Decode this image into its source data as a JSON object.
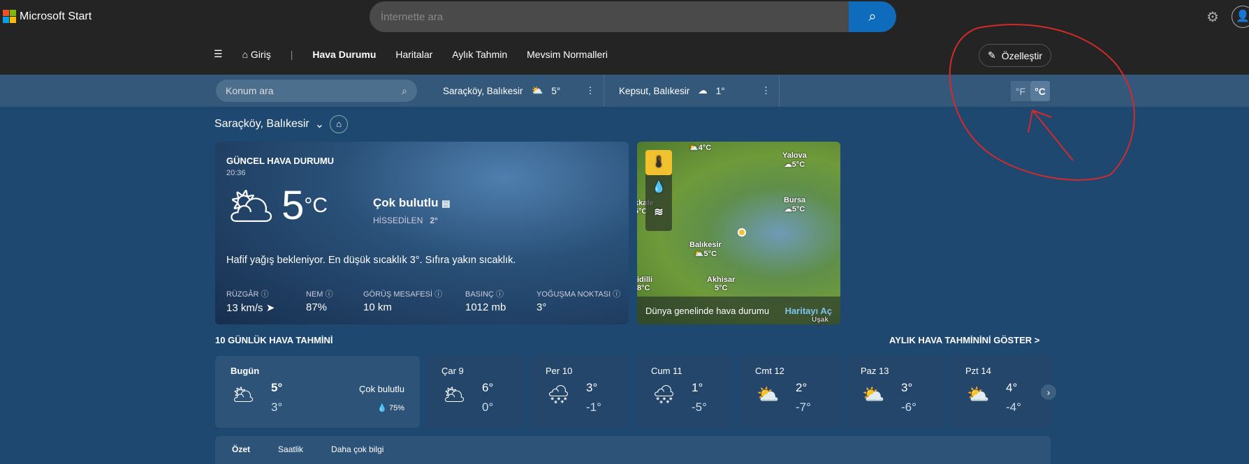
{
  "header": {
    "brand": "Microsoft Start",
    "search_placeholder": "İnternette ara"
  },
  "nav": {
    "items": [
      "Giriş",
      "Hava Durumu",
      "Haritalar",
      "Aylık Tahmin",
      "Mevsim Normalleri"
    ],
    "customize": "Özelleştir"
  },
  "locbar": {
    "placeholder": "Konum ara",
    "favorites": [
      {
        "name": "Saraçköy, Balıkesir",
        "temp": "5°"
      },
      {
        "name": "Kepsut, Balıkesir",
        "temp": "1°"
      }
    ],
    "units": [
      "°F",
      "°C"
    ],
    "active_unit": "°C"
  },
  "location": "Saraçköy, Balıkesir",
  "current": {
    "title": "GÜNCEL HAVA DURUMU",
    "time": "20:36",
    "temp": "5",
    "unit": "°C",
    "condition": "Çok bulutlu",
    "feels_label": "HİSSEDİLEN",
    "feels": "2°",
    "description": "Hafif yağış bekleniyor. En düşük sıcaklık 3°. Sıfıra yakın sıcaklık.",
    "stats": [
      {
        "label": "RÜZGÂR",
        "value": "13 km/s"
      },
      {
        "label": "NEM",
        "value": "87%"
      },
      {
        "label": "GÖRÜŞ MESAFESİ",
        "value": "10 km"
      },
      {
        "label": "BASINÇ",
        "value": "1012 mb"
      },
      {
        "label": "YOĞUŞMA NOKTASI",
        "value": "3°"
      }
    ]
  },
  "map": {
    "labels": [
      {
        "city": "",
        "temp": "4°C"
      },
      {
        "city": "Yalova",
        "temp": "5°C"
      },
      {
        "city": "Bursa",
        "temp": "5°C"
      },
      {
        "city": "Balıkesir",
        "temp": "5°C"
      },
      {
        "city": "kkale",
        "temp": "5°C"
      },
      {
        "city": "idilli",
        "temp": "8°C"
      },
      {
        "city": "Akhisar",
        "temp": "5°C"
      },
      {
        "city": "Uşak",
        "temp": ""
      }
    ],
    "footer": "Dünya genelinde hava durumu",
    "open": "Haritayı Aç"
  },
  "forecast": {
    "title": "10 GÜNLÜK HAVA TAHMİNİ",
    "monthly_link": "AYLIK HAVA TAHMİNİNİ GÖSTER >",
    "days": [
      {
        "day": "Bugün",
        "hi": "5°",
        "lo": "3°",
        "cond": "Çok bulutlu",
        "precip": "75%"
      },
      {
        "day": "Çar 9",
        "hi": "6°",
        "lo": "0°"
      },
      {
        "day": "Per 10",
        "hi": "3°",
        "lo": "-1°"
      },
      {
        "day": "Cum 11",
        "hi": "1°",
        "lo": "-5°"
      },
      {
        "day": "Cmt 12",
        "hi": "2°",
        "lo": "-7°"
      },
      {
        "day": "Paz 13",
        "hi": "3°",
        "lo": "-6°"
      },
      {
        "day": "Pzt 14",
        "hi": "4°",
        "lo": "-4°"
      }
    ]
  },
  "tabs": [
    "Özet",
    "Saatlik",
    "Daha çok bilgi"
  ],
  "colors": {
    "accent": "#0f6cbd",
    "annotation": "#d42a2a",
    "background": "#1f4870"
  }
}
